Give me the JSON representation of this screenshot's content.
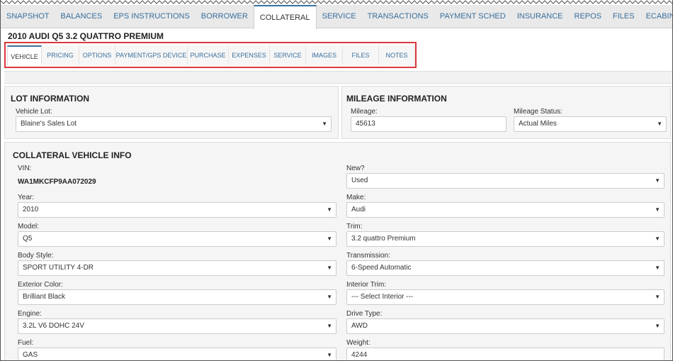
{
  "top_tabs": [
    "SNAPSHOT",
    "BALANCES",
    "EPS INSTRUCTIONS",
    "BORROWER",
    "COLLATERAL",
    "SERVICE",
    "TRANSACTIONS",
    "PAYMENT SCHED",
    "INSURANCE",
    "REPOS",
    "FILES",
    "ECABINET"
  ],
  "active_top_tab": "COLLATERAL",
  "vehicle_title": "2010 AUDI Q5 3.2 QUATTRO PREMIUM",
  "sub_tabs": [
    "VEHICLE",
    "PRICING",
    "OPTIONS",
    "PAYMENT/GPS DEVICE",
    "PURCHASE",
    "EXPENSES",
    "SERVICE",
    "IMAGES",
    "FILES",
    "NOTES"
  ],
  "active_sub_tab": "VEHICLE",
  "lot_info": {
    "heading": "LOT INFORMATION",
    "vehicle_lot_label": "Vehicle Lot:",
    "vehicle_lot_value": "Blaine's Sales Lot"
  },
  "mileage_info": {
    "heading": "MILEAGE INFORMATION",
    "mileage_label": "Mileage:",
    "mileage_value": "45613",
    "status_label": "Mileage Status:",
    "status_value": "Actual Miles"
  },
  "vehicle_info": {
    "heading": "COLLATERAL VEHICLE INFO",
    "vin_label": "VIN:",
    "vin_value": "WA1MKCFP9AA072029",
    "new_label": "New?",
    "new_value": "Used",
    "year_label": "Year:",
    "year_value": "2010",
    "make_label": "Make:",
    "make_value": "Audi",
    "model_label": "Model:",
    "model_value": "Q5",
    "trim_label": "Trim:",
    "trim_value": "3.2 quattro Premium",
    "body_label": "Body Style:",
    "body_value": "SPORT UTILITY 4-DR",
    "trans_label": "Transmission:",
    "trans_value": "6-Speed Automatic",
    "ext_label": "Exterior Color:",
    "ext_value": "Brilliant Black",
    "int_label": "Interior Trim:",
    "int_value": "--- Select Interior ---",
    "engine_label": "Engine:",
    "engine_value": "3.2L V6 DOHC 24V",
    "drive_label": "Drive Type:",
    "drive_value": "AWD",
    "fuel_label": "Fuel:",
    "fuel_value": "GAS",
    "weight_label": "Weight:",
    "weight_value": "4244"
  },
  "icons": {
    "dropdown": "caret-down-icon"
  },
  "colors": {
    "accent": "#3a6f9c",
    "highlight": "#d9393e"
  }
}
